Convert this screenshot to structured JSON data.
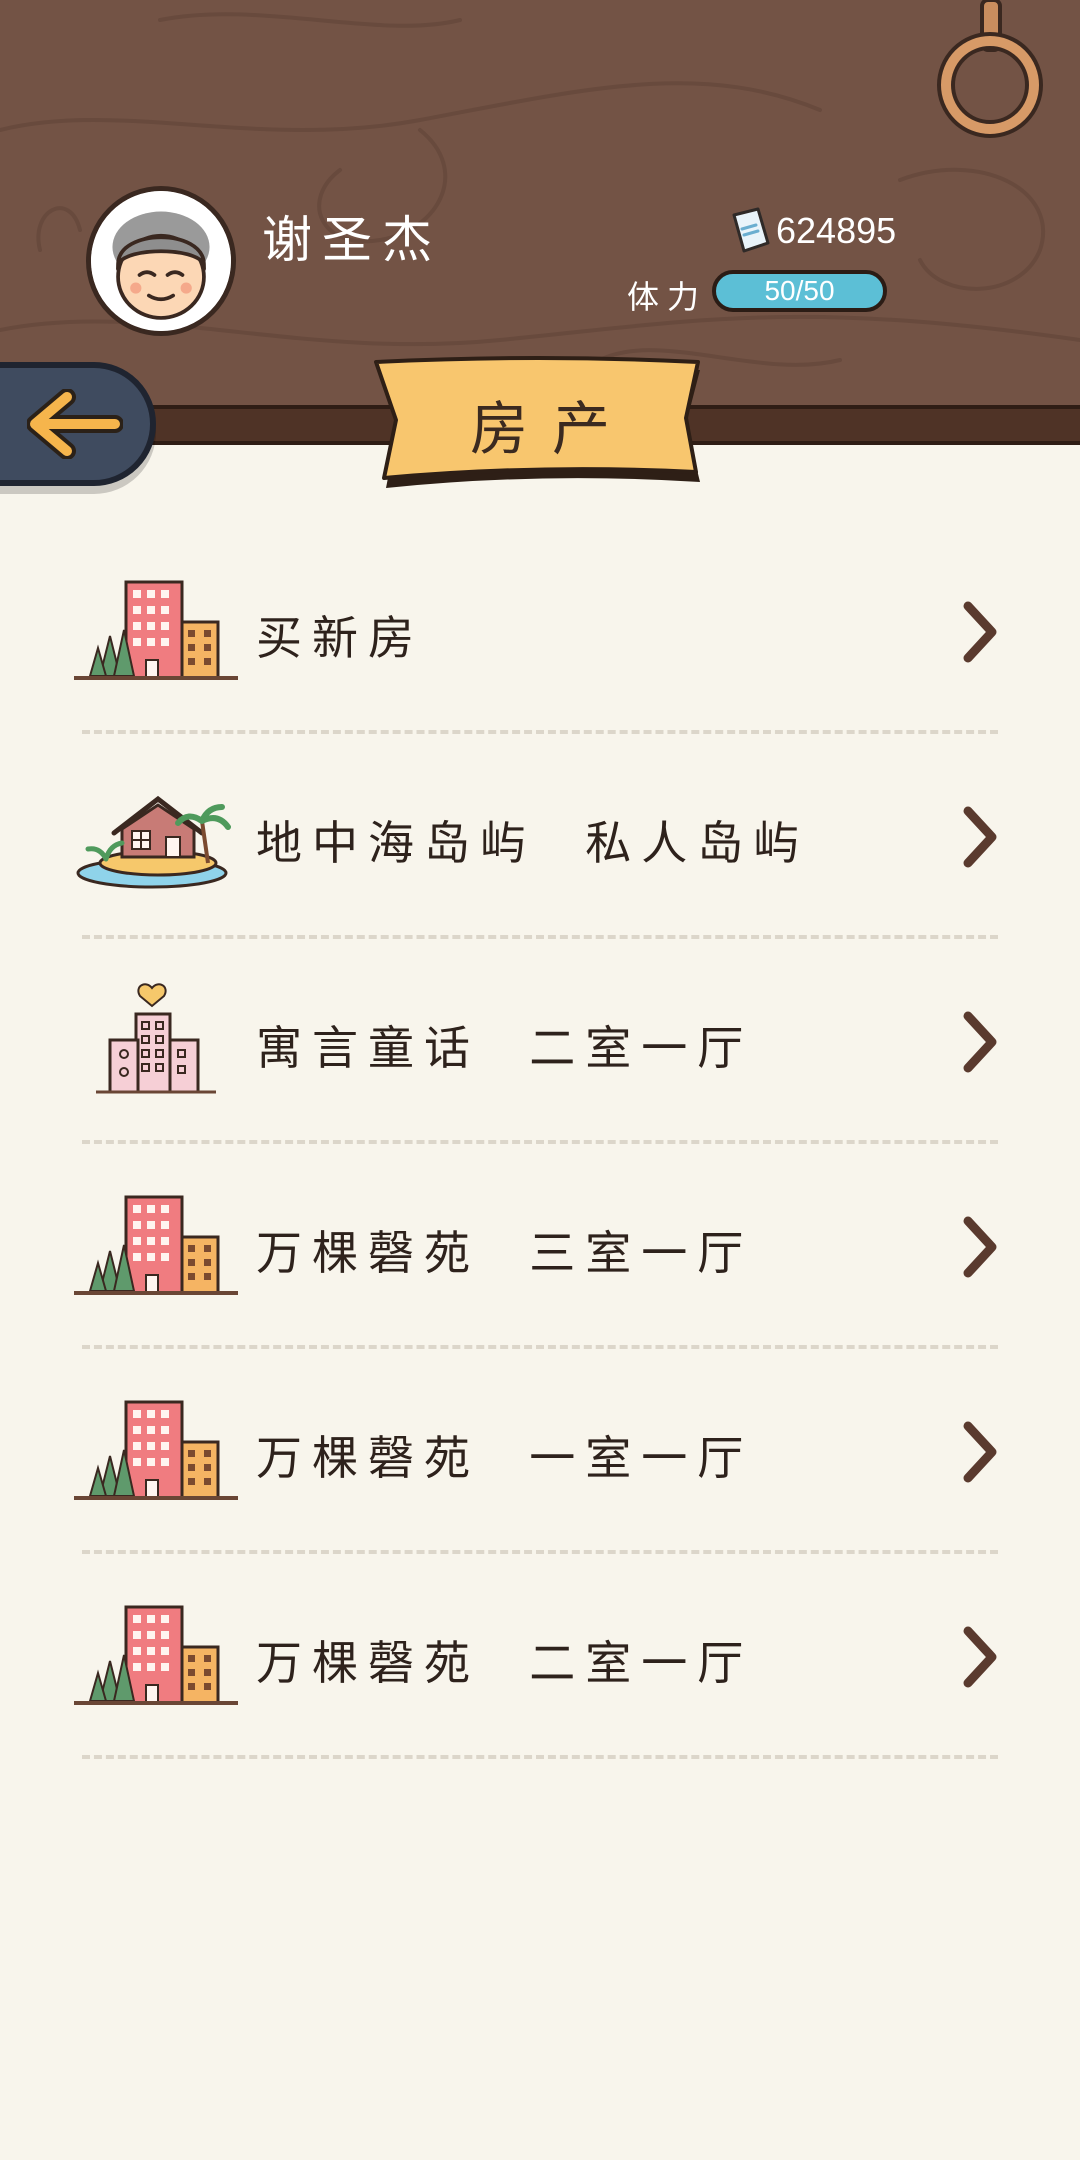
{
  "header": {
    "username": "谢圣杰",
    "money": "624895",
    "stamina_label": "体力",
    "stamina_value": "50/50",
    "stamina_fraction": 1.0,
    "title": "房产",
    "back_icon": "arrow-left-icon",
    "money_icon": "banknote-icon",
    "ring_icon": "hanging-ring-icon"
  },
  "properties": [
    {
      "label": "买新房",
      "icon": "city-buildings-icon"
    },
    {
      "label": "地中海岛屿  私人岛屿",
      "icon": "island-house-icon"
    },
    {
      "label": "寓言童话  二室一厅",
      "icon": "pink-apartment-heart-icon"
    },
    {
      "label": "万棵磬苑  三室一厅",
      "icon": "city-buildings-icon"
    },
    {
      "label": "万棵磬苑  一室一厅",
      "icon": "city-buildings-icon"
    },
    {
      "label": "万棵磬苑  二室一厅",
      "icon": "city-buildings-icon"
    }
  ],
  "colors": {
    "wood": "#735345",
    "banner": "#f8c66e",
    "stamina": "#5cbfd6",
    "background": "#f8f5ec",
    "back_button": "#3f4b5f"
  }
}
